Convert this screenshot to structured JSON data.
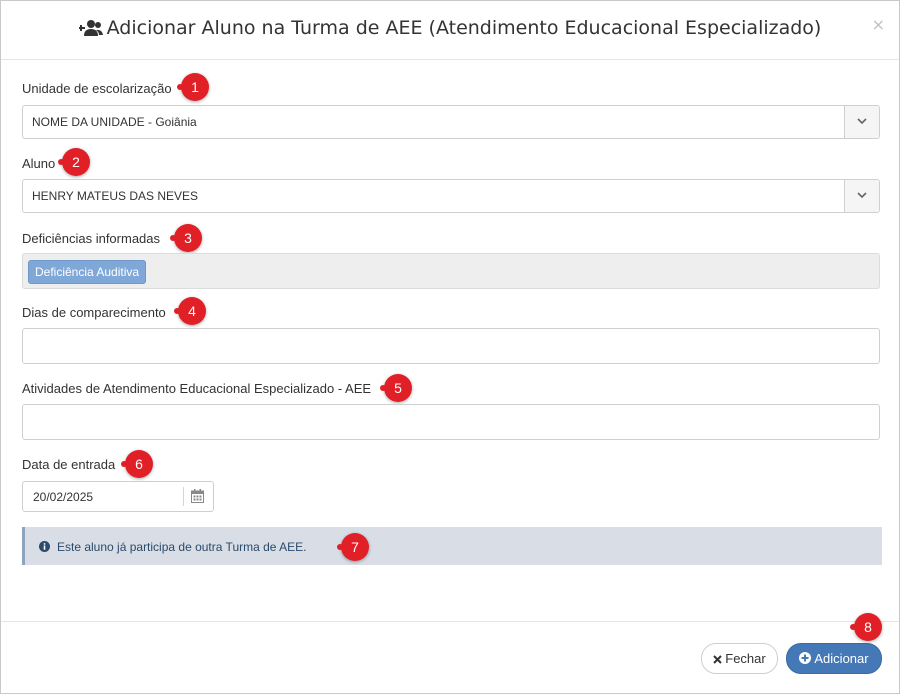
{
  "modal": {
    "title": "Adicionar Aluno na Turma de AEE (Atendimento Educacional Especializado)",
    "close_symbol": "×"
  },
  "fields": {
    "unidade": {
      "label": "Unidade de escolarização",
      "value": "NOME DA UNIDADE - Goiânia",
      "badge": "1"
    },
    "aluno": {
      "label": "Aluno",
      "value": "HENRY MATEUS DAS NEVES",
      "badge": "2"
    },
    "deficiencias": {
      "label": "Deficiências informadas",
      "tags": [
        "Deficiência Auditiva"
      ],
      "badge": "3"
    },
    "dias": {
      "label": "Dias de comparecimento",
      "value": "",
      "badge": "4"
    },
    "atividades": {
      "label": "Atividades de Atendimento Educacional Especializado - AEE",
      "value": "",
      "badge": "5"
    },
    "data_entrada": {
      "label": "Data de entrada",
      "value": "20/02/2025",
      "badge": "6"
    }
  },
  "alert": {
    "text": "Este aluno já participa de outra Turma de AEE.",
    "badge": "7"
  },
  "footer": {
    "close_label": "Fechar",
    "add_label": "Adicionar",
    "badge": "8"
  },
  "colors": {
    "badge": "#e01f26",
    "primary": "#4478b6",
    "tag": "#7fa7d8",
    "alert_bg": "#d8dde6"
  },
  "icons": {
    "title": "user-plus-icon",
    "select": "chevron-down-icon",
    "date": "calendar-icon",
    "alert": "info-circle-icon",
    "close_btn": "times-icon",
    "add_btn": "plus-circle-icon"
  }
}
